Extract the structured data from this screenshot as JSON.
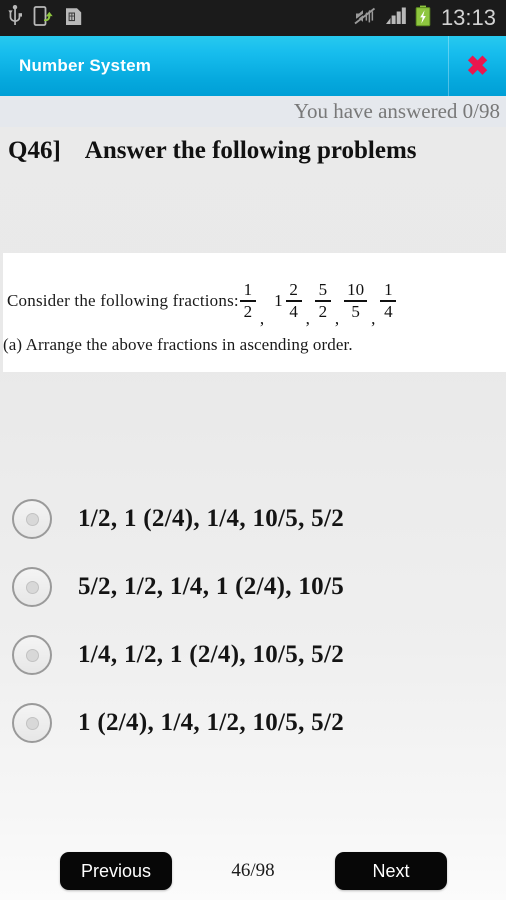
{
  "statusbar": {
    "time": "13:13",
    "left_icons": [
      "usb-icon",
      "sd-transfer-icon",
      "sim-card-icon"
    ],
    "right_icons": [
      "vibrate-mute-icon",
      "signal-bars-icon",
      "battery-charging-icon"
    ],
    "background_color": "#1b1b1b",
    "battery_color": "#8ec63f"
  },
  "titlebar": {
    "title": "Number System",
    "close_label": "✖",
    "accent_color": "#16bced",
    "close_color": "#ea164e"
  },
  "header": {
    "answered_text": "You have answered 0/98",
    "question_number": "Q46]",
    "question_heading": "Answer the following problems"
  },
  "question_image": {
    "prompt": "Consider the following fractions:",
    "fractions": [
      {
        "whole": "",
        "num": "1",
        "den": "2"
      },
      {
        "whole": "1",
        "num": "2",
        "den": "4"
      },
      {
        "whole": "",
        "num": "5",
        "den": "2"
      },
      {
        "whole": "",
        "num": "10",
        "den": "5"
      },
      {
        "whole": "",
        "num": "1",
        "den": "4"
      }
    ],
    "separator": ",",
    "sub_question": "(a) Arrange the above fractions in ascending order."
  },
  "options": [
    {
      "label": "1/2, 1 (2/4), 1/4, 10/5, 5/2",
      "selected": false
    },
    {
      "label": "5/2, 1/2, 1/4, 1 (2/4), 10/5",
      "selected": false
    },
    {
      "label": "1/4, 1/2, 1 (2/4), 10/5, 5/2",
      "selected": false
    },
    {
      "label": "1 (2/4), 1/4, 1/2, 10/5, 5/2",
      "selected": false
    }
  ],
  "footer": {
    "previous_label": "Previous",
    "next_label": "Next",
    "counter": "46/98"
  }
}
